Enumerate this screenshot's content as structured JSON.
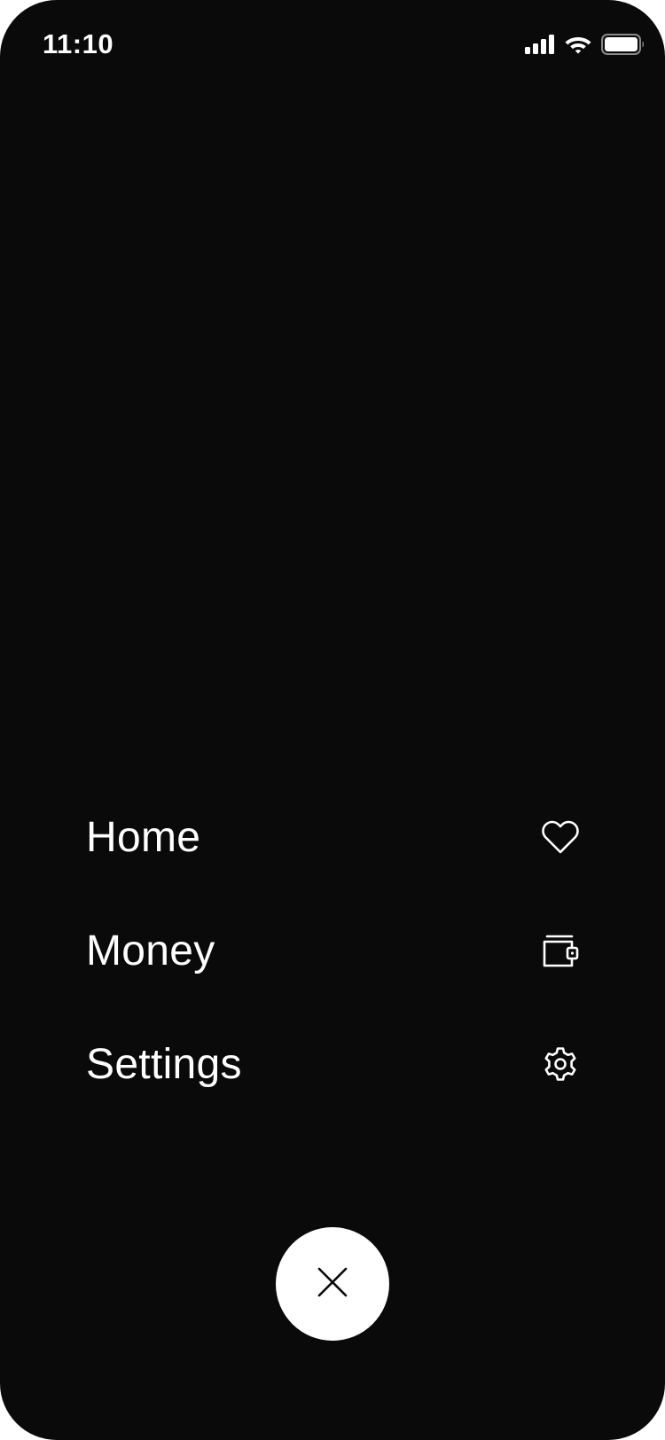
{
  "status_bar": {
    "time": "11:10",
    "icons": [
      "cellular-signal-icon",
      "wifi-icon",
      "battery-icon"
    ]
  },
  "menu": {
    "items": [
      {
        "label": "Home",
        "icon": "heart-icon"
      },
      {
        "label": "Money",
        "icon": "wallet-icon"
      },
      {
        "label": "Settings",
        "icon": "gear-icon"
      }
    ]
  },
  "close_button": {
    "icon": "close-icon"
  },
  "colors": {
    "background": "#0a0a0a",
    "foreground": "#ffffff",
    "button_background": "#ffffff",
    "button_icon": "#0a0a0a"
  }
}
